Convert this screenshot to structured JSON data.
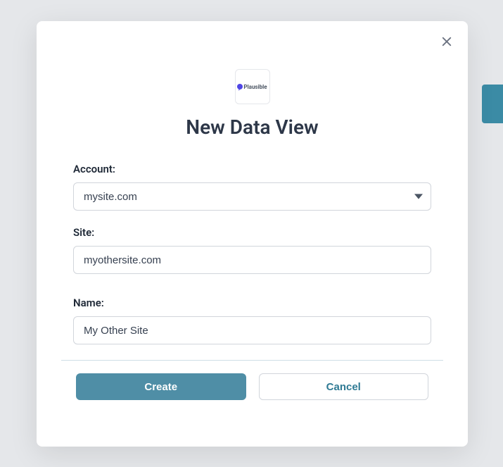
{
  "modal": {
    "logo_text": "Plausible",
    "title": "New Data View",
    "fields": {
      "account": {
        "label": "Account:",
        "value": "mysite.com"
      },
      "site": {
        "label": "Site:",
        "value": "myothersite.com"
      },
      "name": {
        "label": "Name:",
        "value": "My Other Site"
      }
    },
    "buttons": {
      "create": "Create",
      "cancel": "Cancel"
    }
  }
}
